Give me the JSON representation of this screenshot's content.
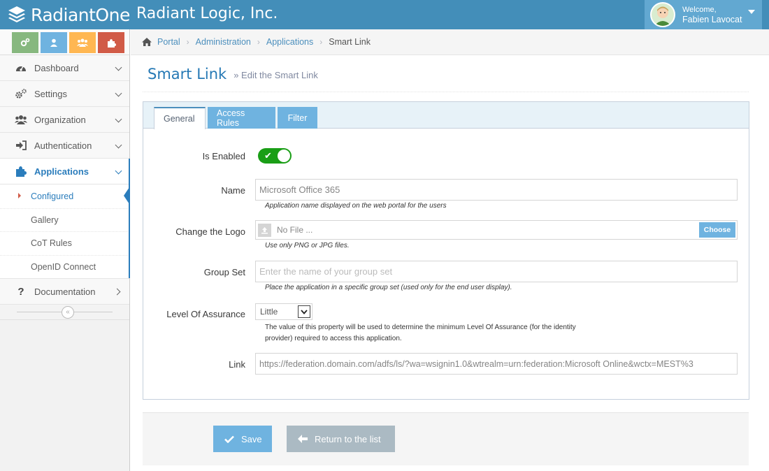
{
  "header": {
    "logo_text": "RadiantOne",
    "company": "Radiant Logic, Inc.",
    "welcome": "Welcome,",
    "user_name": "Fabien Lavocat"
  },
  "shortcuts": [
    {
      "icon": "cogs-icon",
      "color": "#87b87f"
    },
    {
      "icon": "user-icon",
      "color": "#6fb3e0"
    },
    {
      "icon": "users-icon",
      "color": "#ffb752"
    },
    {
      "icon": "puzzle-icon",
      "color": "#d15b47"
    }
  ],
  "sidebar": {
    "items": [
      {
        "label": "Dashboard",
        "icon": "dashboard-icon"
      },
      {
        "label": "Settings",
        "icon": "cogs-icon"
      },
      {
        "label": "Organization",
        "icon": "users-icon"
      },
      {
        "label": "Authentication",
        "icon": "sign-in-icon"
      },
      {
        "label": "Applications",
        "icon": "puzzle-icon",
        "active": true
      },
      {
        "label": "Documentation",
        "icon": "question-icon"
      }
    ],
    "submenu": [
      {
        "label": "Configured",
        "active": true
      },
      {
        "label": "Gallery"
      },
      {
        "label": "CoT Rules"
      },
      {
        "label": "OpenID Connect"
      }
    ],
    "collapse": "«"
  },
  "breadcrumb": {
    "items": [
      "Portal",
      "Administration",
      "Applications"
    ],
    "current": "Smart Link"
  },
  "page": {
    "title": "Smart Link",
    "subtitle": "Edit the Smart Link"
  },
  "tabs": [
    "General",
    "Access Rules",
    "Filter"
  ],
  "form": {
    "enabled": {
      "label": "Is Enabled",
      "value": true
    },
    "name": {
      "label": "Name",
      "value": "Microsoft Office 365",
      "help": "Application name displayed on the web portal for the users"
    },
    "logo": {
      "label": "Change the Logo",
      "file_text": "No File ...",
      "button": "Choose",
      "help": "Use only PNG or JPG files."
    },
    "group_set": {
      "label": "Group Set",
      "placeholder": "Enter the name of your group set",
      "help": "Place the application in a specific group set (used only for the end user display)."
    },
    "loa": {
      "label": "Level Of Assurance",
      "value": "Little",
      "help_line1": "The value of this property will be used to determine the minimum Level Of Assurance (for the identity",
      "help_line2": "provider) required to access this application."
    },
    "link": {
      "label": "Link",
      "value": "https://federation.domain.com/adfs/ls/?wa=wsignin1.0&wtrealm=urn:federation:Microsoft Online&wctx=MEST%3"
    }
  },
  "actions": {
    "save": "Save",
    "return": "Return to the list"
  },
  "colors": {
    "topbar": "#438eb9",
    "accent": "#2679b5",
    "primary_button": "#6fb3e0",
    "toggle_on": "#1a9e16"
  }
}
